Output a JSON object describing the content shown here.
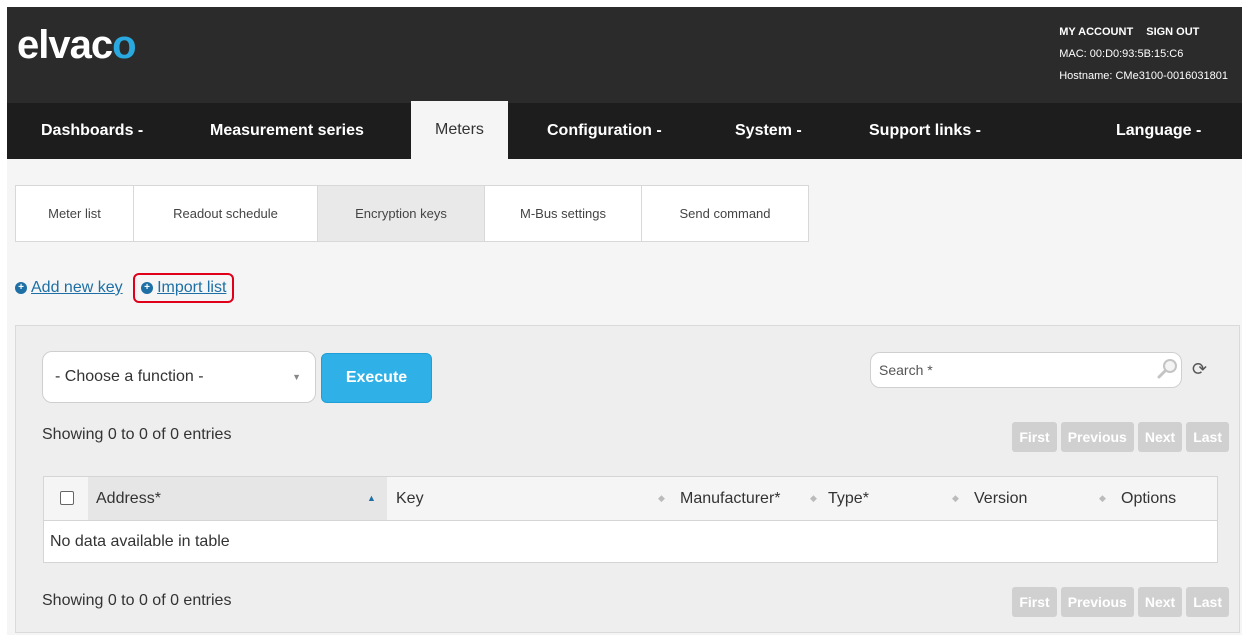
{
  "header": {
    "logo_prefix": "elvac",
    "logo_accent": "o",
    "my_account": "MY ACCOUNT",
    "sign_out": "SIGN OUT",
    "mac": "MAC: 00:D0:93:5B:15:C6",
    "hostname": "Hostname: CMe3100-0016031801"
  },
  "nav": {
    "dashboards": "Dashboards -",
    "measurement_series": "Measurement series",
    "meters": "Meters",
    "configuration": "Configuration -",
    "system": "System -",
    "support_links": "Support links -",
    "language": "Language -"
  },
  "subtabs": {
    "meter_list": "Meter list",
    "readout_schedule": "Readout schedule",
    "encryption_keys": "Encryption keys",
    "mbus_settings": "M-Bus settings",
    "send_command": "Send command"
  },
  "actions": {
    "add_new_key": "Add new key",
    "import_list": "Import list"
  },
  "toolbar": {
    "function_select": "- Choose a function -",
    "execute": "Execute",
    "search_placeholder": "Search *"
  },
  "info": {
    "top": "Showing 0 to 0 of 0 entries",
    "bottom": "Showing 0 to 0 of 0 entries"
  },
  "pager": {
    "first": "First",
    "previous": "Previous",
    "next": "Next",
    "last": "Last"
  },
  "table": {
    "col_address": "Address*",
    "col_key": "Key",
    "col_manufacturer": "Manufacturer*",
    "col_type": "Type*",
    "col_version": "Version",
    "col_options": "Options",
    "empty": "No data available in table"
  },
  "colors": {
    "accent": "#29a9e0",
    "header_bg": "#2b2b2b",
    "nav_bg": "#1d1d1d",
    "execute_bg": "#2fb1e7",
    "link": "#1d6fa5",
    "highlight": "#e0001a"
  }
}
